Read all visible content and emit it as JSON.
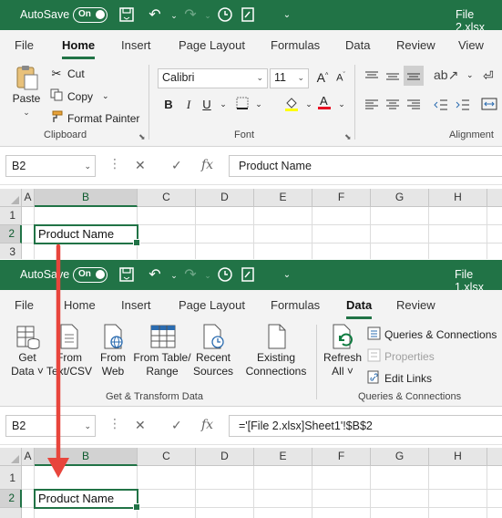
{
  "window1": {
    "autosave_label": "AutoSave",
    "autosave_state": "On",
    "file_title": "File 2.xlsx",
    "tabs": [
      "File",
      "Home",
      "Insert",
      "Page Layout",
      "Formulas",
      "Data",
      "Review",
      "View"
    ],
    "active_tab": "Home",
    "clipboard": {
      "paste": "Paste",
      "cut": "Cut",
      "copy": "Copy",
      "format_painter": "Format Painter",
      "group_label": "Clipboard"
    },
    "font": {
      "name": "Calibri",
      "size": "11",
      "bold": "B",
      "italic": "I",
      "underline": "U",
      "group_label": "Font"
    },
    "alignment": {
      "group_label": "Alignment"
    },
    "name_box": "B2",
    "formula_value": "Product Name",
    "columns": [
      "A",
      "B",
      "C",
      "D",
      "E",
      "F",
      "G",
      "H"
    ],
    "rows": [
      "1",
      "2",
      "3"
    ],
    "active_cell_text": "Product Name"
  },
  "window2": {
    "autosave_label": "AutoSave",
    "autosave_state": "On",
    "file_title": "File 1.xlsx",
    "tabs": [
      "File",
      "Home",
      "Insert",
      "Page Layout",
      "Formulas",
      "Data",
      "Review"
    ],
    "active_tab": "Data",
    "buttons": {
      "get_data_1": "Get",
      "get_data_2": "Data ˅",
      "from_text_1": "From",
      "from_text_2": "Text/CSV",
      "from_web_1": "From",
      "from_web_2": "Web",
      "from_table_1": "From Table/",
      "from_table_2": "Range",
      "recent_1": "Recent",
      "recent_2": "Sources",
      "existing_1": "Existing",
      "existing_2": "Connections",
      "refresh_1": "Refresh",
      "refresh_2": "All ˅",
      "queries_connections": "Queries & Connections",
      "properties": "Properties",
      "edit_links": "Edit Links"
    },
    "group_get_transform": "Get & Transform Data",
    "group_queries": "Queries & Connections",
    "name_box": "B2",
    "formula_value": "='[File 2.xlsx]Sheet1'!$B$2",
    "columns": [
      "A",
      "B",
      "C",
      "D",
      "E",
      "F",
      "G",
      "H"
    ],
    "rows": [
      "1",
      "2"
    ],
    "active_cell_text": "Product Name"
  },
  "colors": {
    "excel_green": "#217346",
    "arrow_red": "#e8453c",
    "ribbon_bg": "#f3f3f3"
  }
}
